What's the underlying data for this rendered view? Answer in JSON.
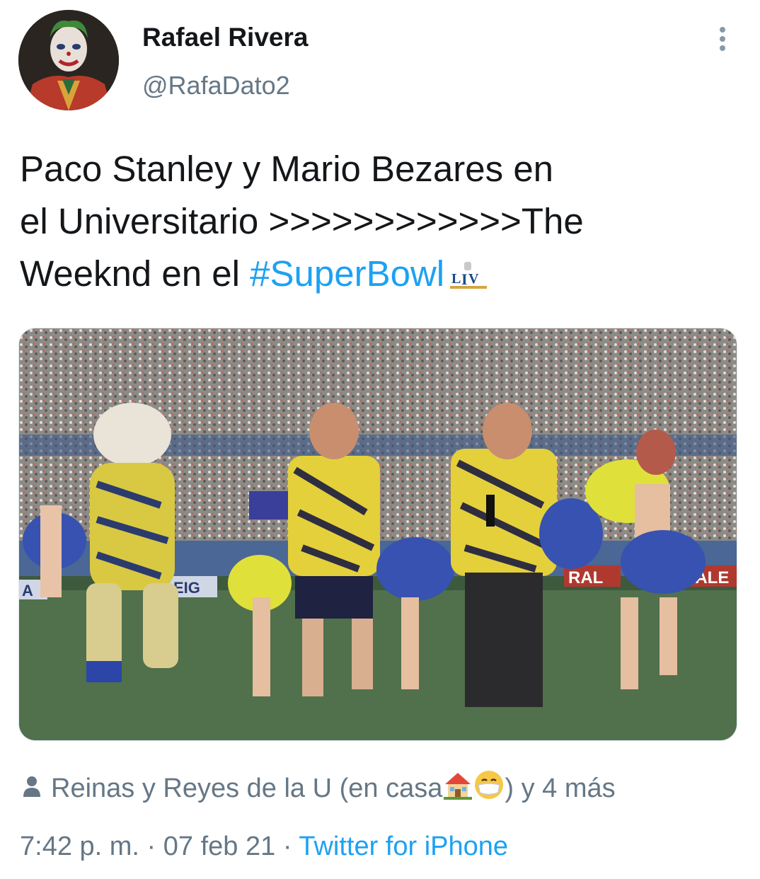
{
  "tweet": {
    "author_name": "Rafael Rivera",
    "author_handle": "@RafaDato2",
    "text_part1": "Paco Stanley y Mario Bezares en\nel Universitario >>>>>>>>>>>>The\nWeeknd en el ",
    "hashtag": "#SuperBowl",
    "tagged_text_before": "Reinas y Reyes de la U (en casa ",
    "tagged_text_after": ") y 4 más",
    "time": "7:42 p. m.",
    "separator": "·",
    "date": "07 feb 21",
    "source": "Twitter for iPhone"
  },
  "media": {
    "banner_left": "EIG",
    "banner_right_1": "RAL",
    "banner_right_2": "RALE",
    "banner_far_left": "A"
  },
  "icons": [
    "avatar-joker",
    "more-options-icon",
    "superbowl-liv-emoji",
    "person-icon",
    "house-emoji",
    "mask-face-emoji"
  ],
  "colors": {
    "link": "#1da1f2",
    "secondary": "#657786",
    "text": "#14171a"
  }
}
